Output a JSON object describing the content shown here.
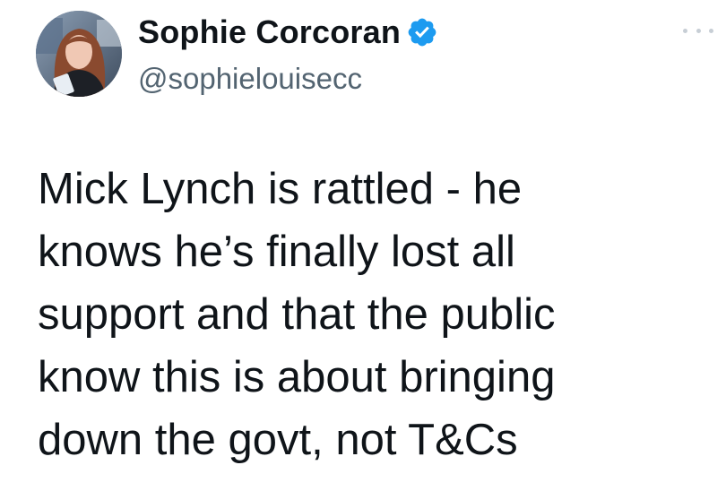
{
  "tweet": {
    "author": {
      "display_name": "Sophie Corcoran",
      "handle": "@sophielouisecc",
      "verified": true
    },
    "text_lines": [
      "Mick Lynch is rattled - he",
      "knows he’s finally lost all",
      "support and that the public",
      "know this is about bringing",
      "down the govt, not T&Cs"
    ]
  },
  "colors": {
    "verified_badge": "#1d9bf0",
    "handle_text": "#536471",
    "body_text": "#0f1419"
  },
  "icons": {
    "verified": "verified-badge-icon",
    "more": "more-options-icon"
  }
}
